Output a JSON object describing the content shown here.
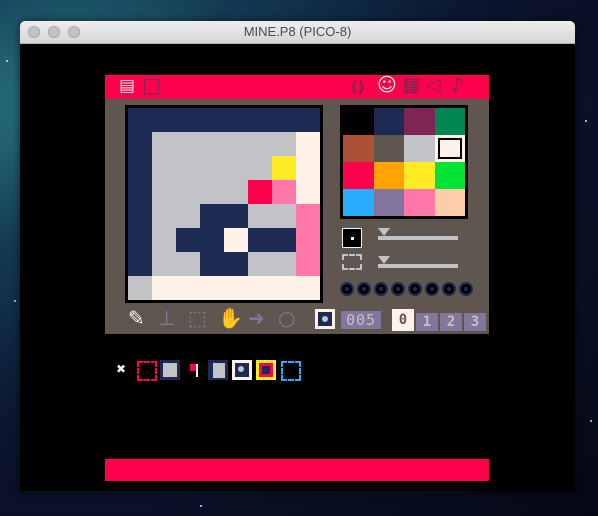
{
  "window": {
    "title": "MINE.P8 (PICO-8)"
  },
  "colors": {
    "pink": "#ff004d",
    "dark_grey": "#5f574f",
    "lavender": "#83769c",
    "dark_blue": "#1d2b53",
    "light_grey": "#c2c3c7",
    "white": "#fff1e8",
    "yellow": "#ffec27"
  },
  "palette": [
    "#000000",
    "#1d2b53",
    "#7e2553",
    "#008751",
    "#ab5236",
    "#5f574f",
    "#c2c3c7",
    "#fff1e8",
    "#ff004d",
    "#ffa300",
    "#ffec27",
    "#00e436",
    "#29adff",
    "#83769c",
    "#ff77a8",
    "#ffccaa"
  ],
  "palette_selected_index": 7,
  "sprite_pixels": [
    "11111111",
    "16666667",
    "166666a7",
    "166668e7",
    "1661166e",
    "1611711e",
    "1661166e",
    "67777777"
  ],
  "header_icons": [
    {
      "name": "code-editor-tab-icon",
      "glyph": "▤"
    },
    {
      "name": "fullscreen-tab-icon",
      "glyph": "□"
    },
    {
      "name": "code-tab-icon",
      "glyph": "()"
    },
    {
      "name": "sprite-tab-icon",
      "glyph": "☺"
    },
    {
      "name": "map-tab-icon",
      "glyph": "▦"
    },
    {
      "name": "sfx-tab-icon",
      "glyph": "◁"
    },
    {
      "name": "music-tab-icon",
      "glyph": "♪"
    }
  ],
  "tools": [
    {
      "name": "pencil-tool-icon",
      "glyph": "✎",
      "active": true
    },
    {
      "name": "stamp-tool-icon",
      "glyph": "⊥",
      "active": false
    },
    {
      "name": "select-tool-icon",
      "glyph": "⬚",
      "active": false
    },
    {
      "name": "pan-tool-icon",
      "glyph": "✋",
      "active": false
    },
    {
      "name": "fill-tool-icon",
      "glyph": "➜",
      "active": false
    },
    {
      "name": "circle-tool-icon",
      "glyph": "○",
      "active": false
    }
  ],
  "sprite_number": "005",
  "sheet_tabs": [
    "0",
    "1",
    "2",
    "3"
  ],
  "active_sheet_tab": 0,
  "flags_count": 8,
  "tray_icons": [
    "empty-tile-icon",
    "dashed-frame-tile-icon",
    "grey-block-tile-icon",
    "red-flag-tile-icon",
    "dark-frame-tile-icon",
    "mine-tile-icon",
    "mine-exploded-tile-icon",
    "blue-frame-tile-icon"
  ],
  "tray_selected_index": 5
}
